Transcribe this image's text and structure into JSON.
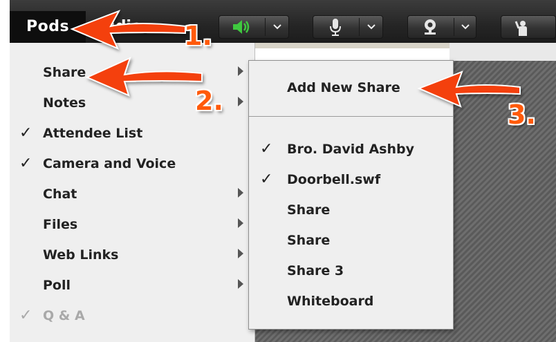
{
  "toolbar": {
    "pods_label": "Pods",
    "audio_label_partial": "Audio",
    "speaker_color": "#3fc93f",
    "icons": [
      "speaker-icon",
      "microphone-icon",
      "webcam-icon",
      "raise-hand-icon"
    ]
  },
  "pods_menu": {
    "items": [
      {
        "label": "Share",
        "checked": false,
        "submenu": true,
        "disabled": false
      },
      {
        "label": "Notes",
        "checked": false,
        "submenu": true,
        "disabled": false
      },
      {
        "label": "Attendee List",
        "checked": true,
        "submenu": false,
        "disabled": false
      },
      {
        "label": "Camera and Voice",
        "checked": true,
        "submenu": false,
        "disabled": false
      },
      {
        "label": "Chat",
        "checked": false,
        "submenu": true,
        "disabled": false
      },
      {
        "label": "Files",
        "checked": false,
        "submenu": true,
        "disabled": false
      },
      {
        "label": "Web Links",
        "checked": false,
        "submenu": true,
        "disabled": false
      },
      {
        "label": "Poll",
        "checked": false,
        "submenu": true,
        "disabled": false
      },
      {
        "label": "Q & A",
        "checked": true,
        "submenu": false,
        "disabled": true
      }
    ]
  },
  "share_menu": {
    "add_new": "Add New Share",
    "items": [
      {
        "label": "Bro. David Ashby",
        "checked": true
      },
      {
        "label": "Doorbell.swf",
        "checked": true
      },
      {
        "label": "Share",
        "checked": false
      },
      {
        "label": "Share",
        "checked": false
      },
      {
        "label": "Share 3",
        "checked": false
      },
      {
        "label": "Whiteboard",
        "checked": false
      }
    ]
  },
  "callouts": {
    "step1": "1.",
    "step2": "2.",
    "step3": "3."
  },
  "colors": {
    "callout": "#ff5a0a",
    "arrow": "#f4410f"
  }
}
